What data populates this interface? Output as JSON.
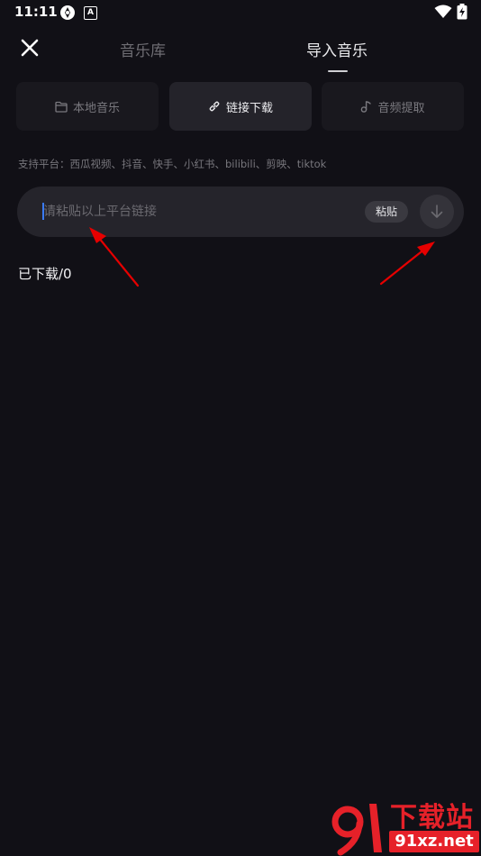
{
  "status_bar": {
    "time": "11:11",
    "notification_letter": "A",
    "icons": [
      "app-notification-icon",
      "a-notification-icon",
      "wifi-icon",
      "battery-charging-icon"
    ]
  },
  "header": {
    "close_icon": "close-icon",
    "tabs": [
      {
        "label": "音乐库",
        "active": false
      },
      {
        "label": "导入音乐",
        "active": true
      }
    ]
  },
  "sources": [
    {
      "label": "本地音乐",
      "icon": "folder-icon",
      "active": false
    },
    {
      "label": "链接下载",
      "icon": "link-icon",
      "active": true
    },
    {
      "label": "音频提取",
      "icon": "music-note-icon",
      "active": false
    }
  ],
  "platforms_text": "支持平台：西瓜视频、抖音、快手、小红书、bilibili、剪映、tiktok",
  "link_input": {
    "value": "",
    "placeholder": "请粘贴以上平台链接"
  },
  "paste_label": "粘贴",
  "download_icon": "download-arrow-icon",
  "downloaded_label": "已下载/0",
  "watermark": {
    "title": "下载站",
    "url": "91xz.net",
    "color": "#e62129"
  },
  "colors": {
    "background": "#111016",
    "annotation_arrow": "#e60000",
    "caret": "#3a7bf7"
  }
}
